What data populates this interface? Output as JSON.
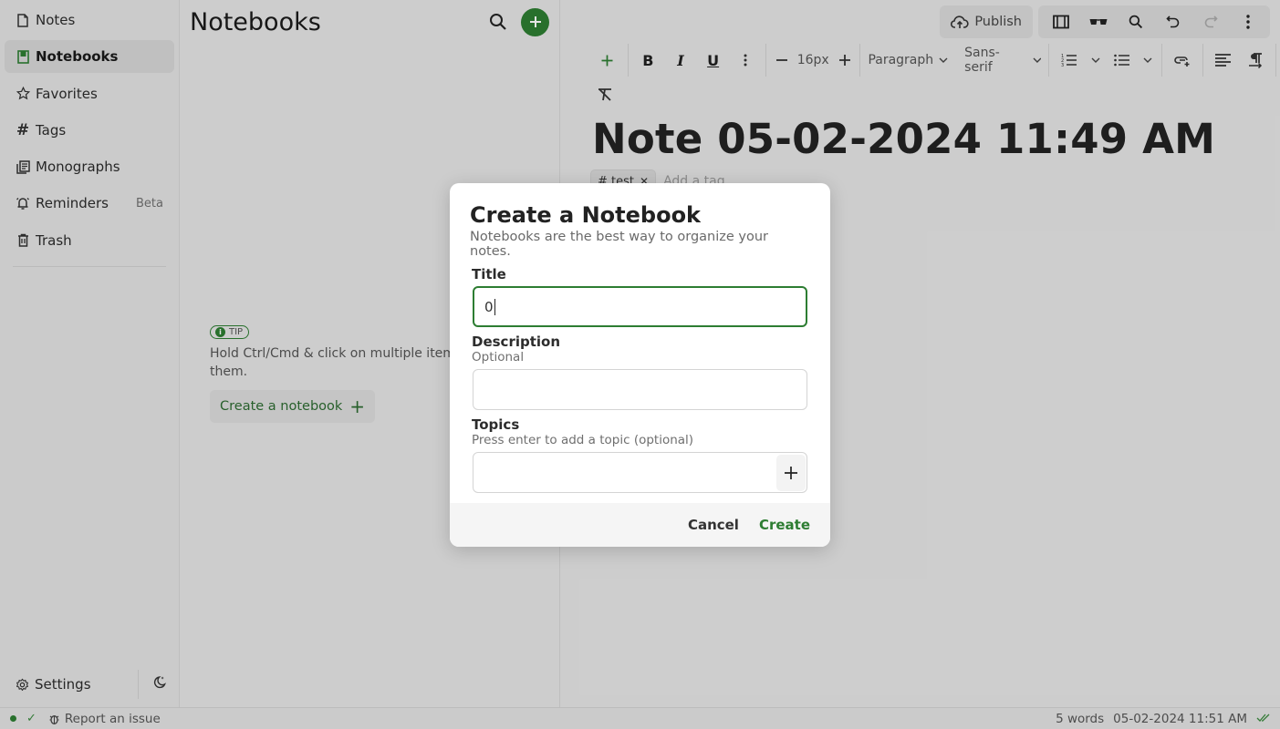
{
  "sidebar": {
    "items": [
      {
        "label": "Notes",
        "icon": "note-icon",
        "active": false
      },
      {
        "label": "Notebooks",
        "icon": "notebook-icon",
        "active": true
      },
      {
        "label": "Favorites",
        "icon": "star-icon",
        "active": false
      },
      {
        "label": "Tags",
        "icon": "hash-icon",
        "active": false
      },
      {
        "label": "Monographs",
        "icon": "monograph-icon",
        "active": false
      },
      {
        "label": "Reminders",
        "icon": "bell-icon",
        "active": false,
        "badge": "Beta"
      },
      {
        "label": "Trash",
        "icon": "trash-icon",
        "active": false
      }
    ],
    "settings_label": "Settings"
  },
  "list": {
    "title": "Notebooks",
    "tip_badge": "TIP",
    "tip_text": "Hold Ctrl/Cmd & click on multiple items to select them.",
    "create_label": "Create a notebook"
  },
  "editor": {
    "publish_label": "Publish",
    "font_size": "16px",
    "block_type": "Paragraph",
    "font_family": "Sans-serif",
    "note_title": "Note 05-02-2024 11:49 AM",
    "tags": [
      "test"
    ],
    "tag_placeholder": "Add a tag"
  },
  "dialog": {
    "title": "Create a Notebook",
    "subtitle": "Notebooks are the best way to organize your notes.",
    "title_label": "Title",
    "title_value": "0",
    "description_label": "Description",
    "description_hint": "Optional",
    "description_value": "",
    "topics_label": "Topics",
    "topics_hint": "Press enter to add a topic (optional)",
    "topics_value": "",
    "cancel_label": "Cancel",
    "create_label": "Create"
  },
  "statusbar": {
    "report_label": "Report an issue",
    "word_count": "5 words",
    "timestamp": "05-02-2024 11:51 AM"
  },
  "colors": {
    "accent": "#2d7d32",
    "background": "#e5e5e5"
  }
}
